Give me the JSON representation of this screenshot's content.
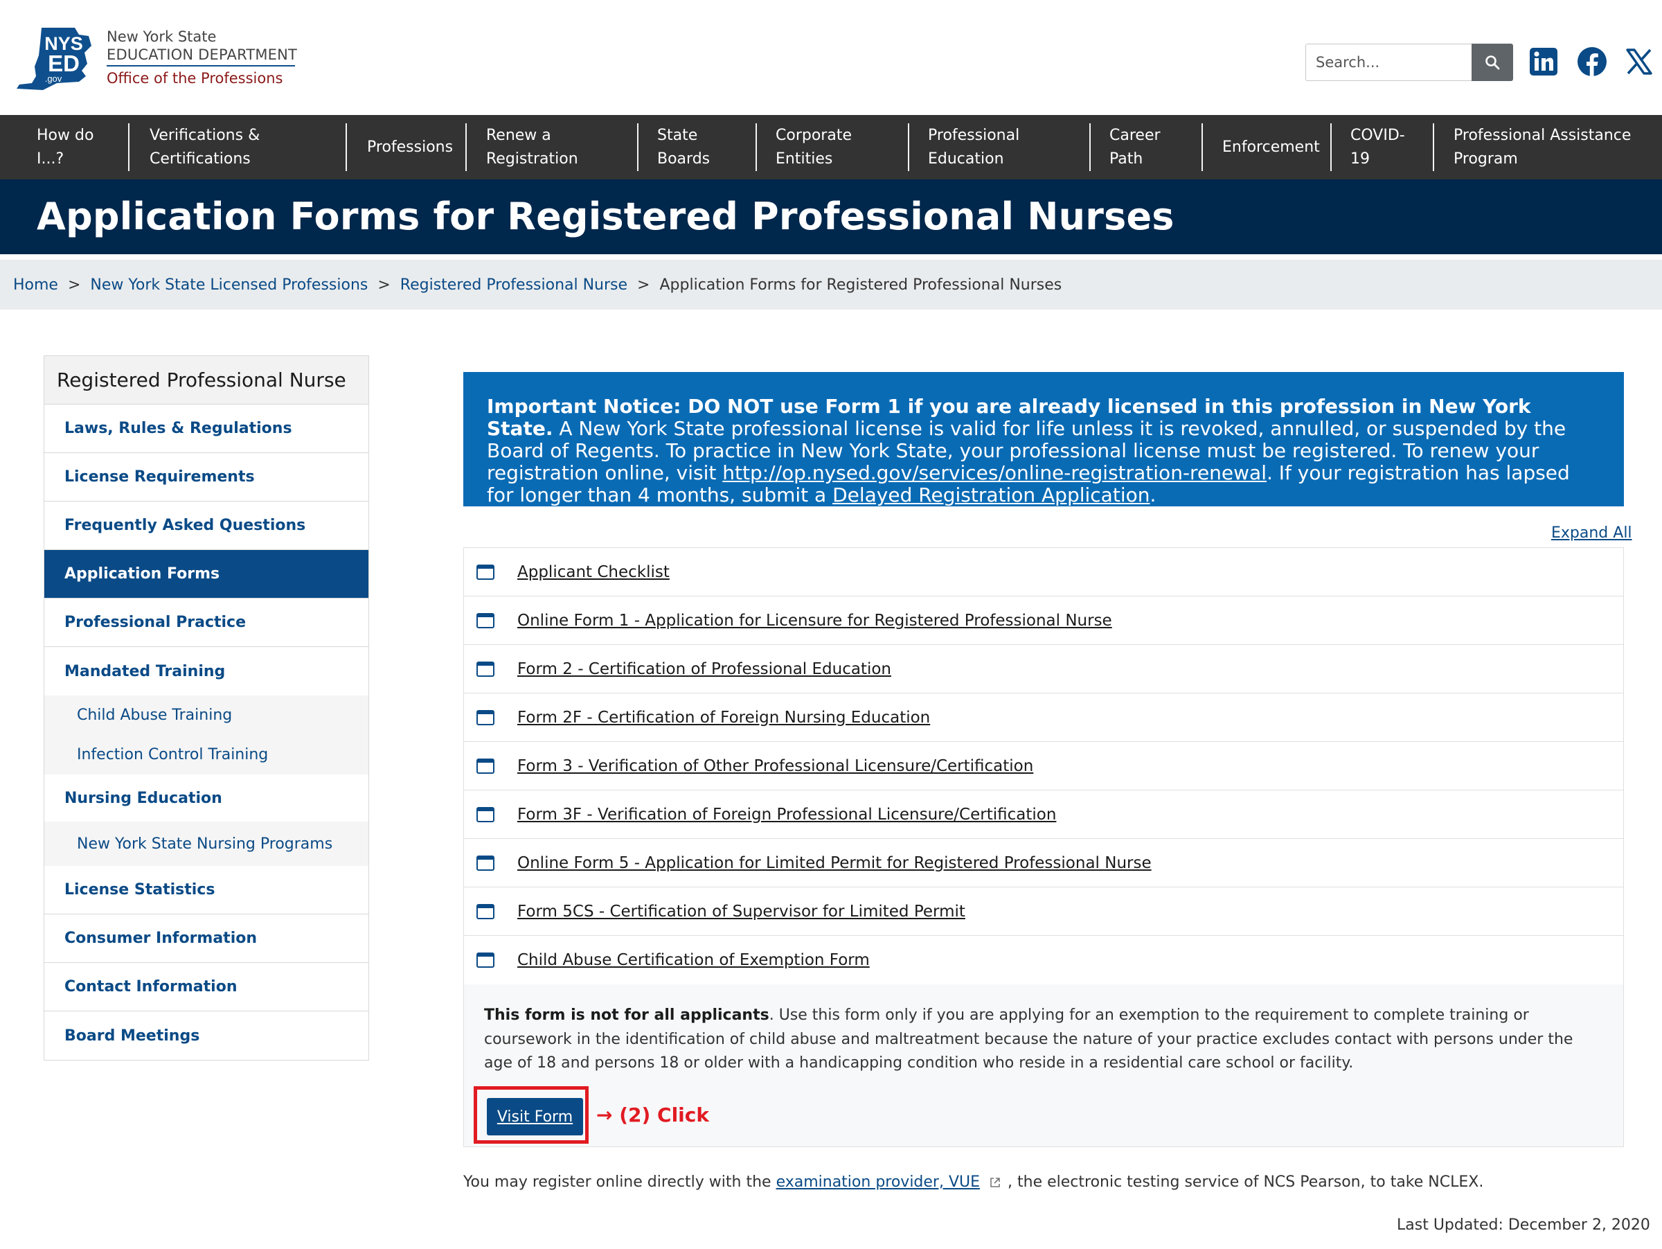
{
  "header": {
    "logo": {
      "mark_top": "NYS",
      "mark_bottom": "ED",
      "mark_domain": ".gov",
      "line1": "New York State",
      "line2": "EDUCATION DEPARTMENT",
      "line3": "Office of the Professions"
    },
    "search": {
      "placeholder": "Search..."
    },
    "social": [
      "linkedin-icon",
      "facebook-icon",
      "x-icon"
    ]
  },
  "nav": {
    "items": [
      {
        "label": "How do I...?"
      },
      {
        "label": "Verifications & Certifications"
      },
      {
        "label": "Professions"
      },
      {
        "label": "Renew a Registration"
      },
      {
        "label": "State Boards"
      },
      {
        "label": "Corporate Entities"
      },
      {
        "label": "Professional Education"
      },
      {
        "label": "Career Path"
      },
      {
        "label": "Enforcement"
      },
      {
        "label": "COVID-19"
      },
      {
        "label": "Professional Assistance Program"
      }
    ]
  },
  "page": {
    "title": "Application Forms for Registered Professional Nurses"
  },
  "breadcrumb": {
    "items": [
      "Home",
      "New York State Licensed Professions",
      "Registered Professional Nurse"
    ],
    "separator": ">",
    "current": "Application Forms for Registered Professional Nurses"
  },
  "sidebar": {
    "heading": "Registered Professional Nurse",
    "items": [
      {
        "label": "Laws, Rules & Regulations"
      },
      {
        "label": "License Requirements"
      },
      {
        "label": "Frequently Asked Questions"
      },
      {
        "label": "Application Forms"
      },
      {
        "label": "Professional Practice"
      },
      {
        "label": "Mandated Training"
      },
      {
        "label": "Child Abuse Training"
      },
      {
        "label": "Infection Control Training"
      },
      {
        "label": "Nursing Education"
      },
      {
        "label": "New York State Nursing Programs"
      },
      {
        "label": "License Statistics"
      },
      {
        "label": "Consumer Information"
      },
      {
        "label": "Contact Information"
      },
      {
        "label": "Board Meetings"
      }
    ]
  },
  "notice": {
    "bold": "Important Notice: DO NOT use Form 1 if you are already licensed in this profession in New York State.",
    "text1": " A New York State professional license is valid for life unless it is revoked, annulled, or suspended by the Board of Regents. To practice in New York State, your professional license must be registered. To renew your registration online, visit ",
    "link1": "http://op.nysed.gov/services/online-registration-renewal",
    "text2": ". If your registration has lapsed for longer than 4 months, submit a ",
    "link2": "Delayed Registration Application",
    "text3": "."
  },
  "accordion": {
    "expand_all": "Expand All",
    "items": [
      {
        "title": "Applicant Checklist"
      },
      {
        "title": "Online Form 1 - Application for Licensure for Registered Professional Nurse"
      },
      {
        "title": "Form 2 - Certification of Professional Education"
      },
      {
        "title": "Form 2F - Certification of Foreign Nursing Education"
      },
      {
        "title": "Form 3 - Verification of Other Professional Licensure/Certification"
      },
      {
        "title": "Form 3F - Verification of Foreign Professional Licensure/Certification"
      },
      {
        "title": "Online Form 5 - Application for Limited Permit for Registered Professional Nurse"
      },
      {
        "title": "Form 5CS - Certification of Supervisor for Limited Permit"
      },
      {
        "title": "Child Abuse Certification of Exemption Form"
      }
    ],
    "expanded": {
      "bold": "This form is not for all applicants",
      "text": ". Use this form only if you are applying for an exemption to the requirement to complete training or coursework in the identification of child abuse and maltreatment because the nature of your practice excludes contact with persons under the age of 18 and persons 18 or older with a handicapping condition who reside in a residential care school or facility.",
      "button": "Visit Form",
      "annotation": "→ (2) Click"
    }
  },
  "footer": {
    "note_before": "You may register online directly with the ",
    "note_link": "examination provider, VUE",
    "note_after": " , the electronic testing service of NCS Pearson, to take NCLEX.",
    "last_updated": "Last Updated: December 2, 2020"
  },
  "colors": {
    "nav_bg": "#333333",
    "banner_bg": "#00274c",
    "link": "#0a4a86",
    "notice_bg": "#0a6bb5",
    "annotation": "#e11b22"
  }
}
